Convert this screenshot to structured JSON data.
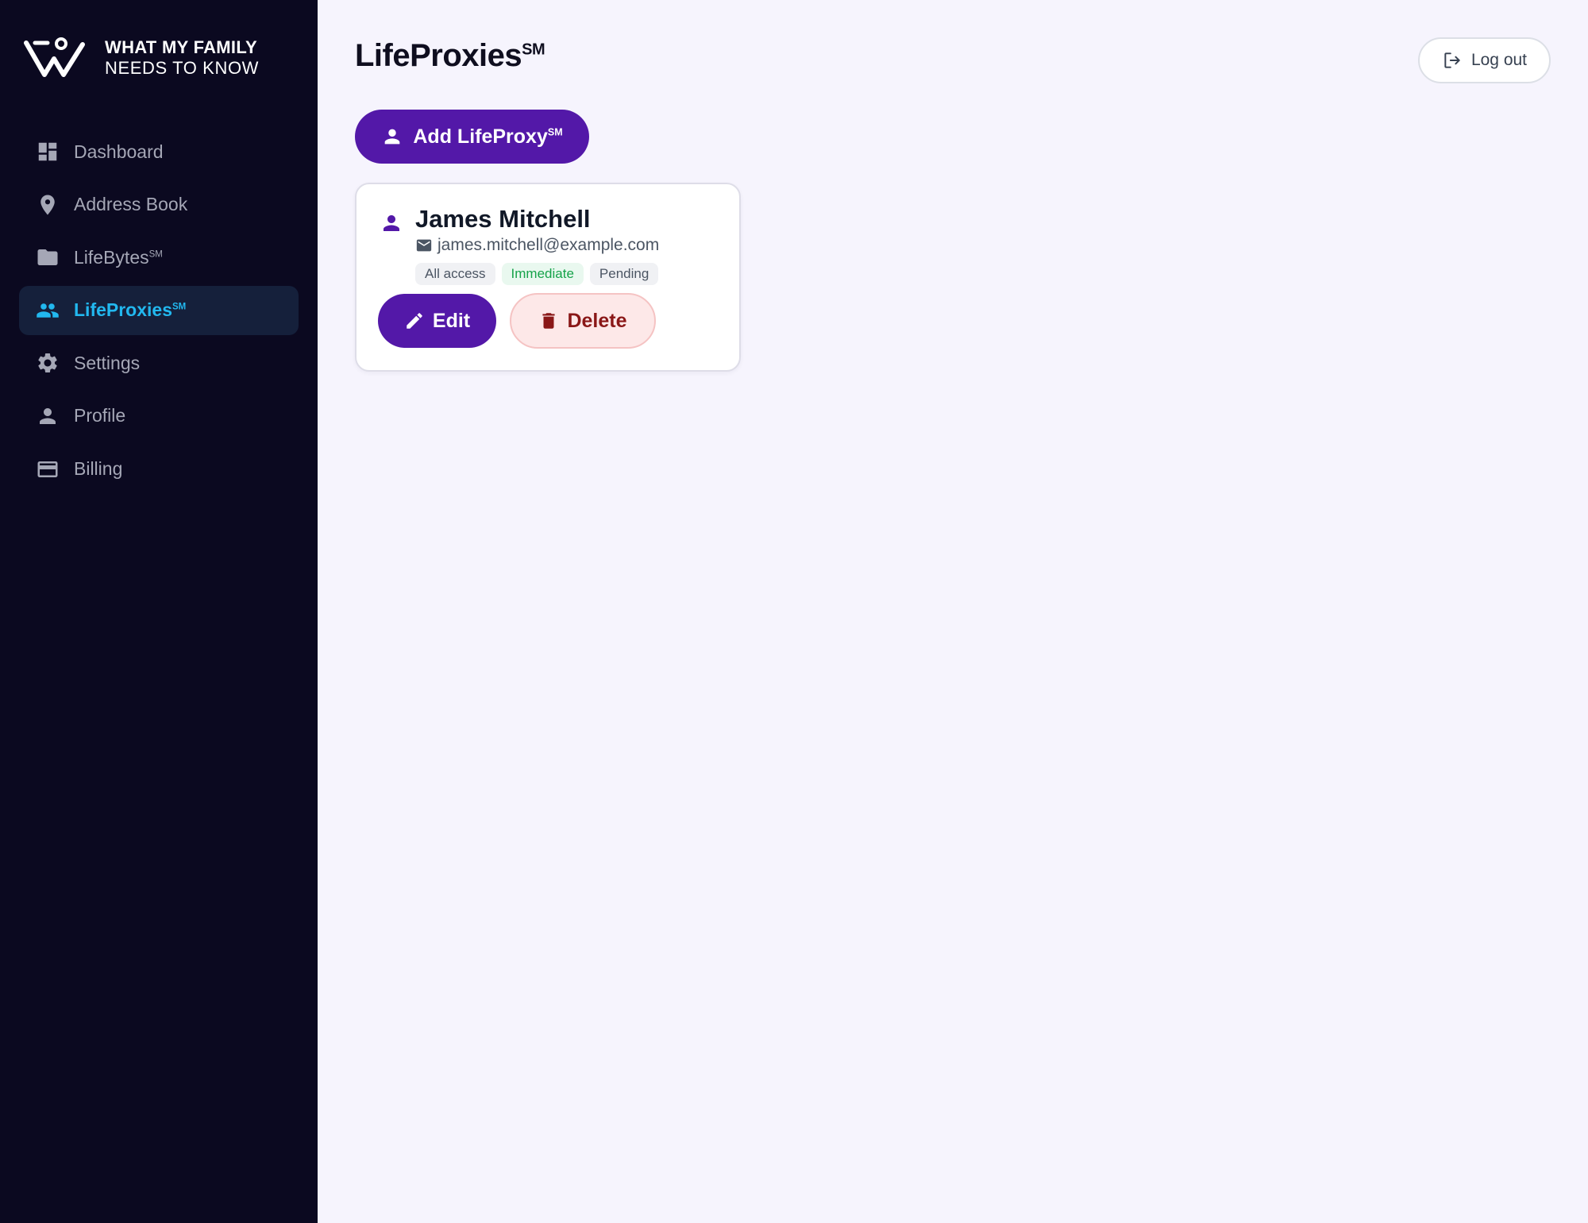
{
  "brand": {
    "line1": "WHAT MY FAMILY",
    "line2": "NEEDS TO KNOW"
  },
  "sidebar": {
    "items": [
      {
        "label": "Dashboard",
        "sup": "",
        "icon": "dashboard-icon",
        "active": false
      },
      {
        "label": "Address Book",
        "sup": "",
        "icon": "location-pin-icon",
        "active": false
      },
      {
        "label": "LifeBytes",
        "sup": "SM",
        "icon": "folder-icon",
        "active": false
      },
      {
        "label": "LifeProxies",
        "sup": "SM",
        "icon": "people-icon",
        "active": true
      },
      {
        "label": "Settings",
        "sup": "",
        "icon": "gear-icon",
        "active": false
      },
      {
        "label": "Profile",
        "sup": "",
        "icon": "person-icon",
        "active": false
      },
      {
        "label": "Billing",
        "sup": "",
        "icon": "credit-card-icon",
        "active": false
      }
    ]
  },
  "page": {
    "title": "LifeProxies",
    "title_sup": "SM"
  },
  "header": {
    "logout_label": "Log out"
  },
  "actions": {
    "add_label": "Add LifeProxy",
    "add_sup": "SM"
  },
  "proxies": [
    {
      "name": "James Mitchell",
      "email": "james.mitchell@example.com",
      "badges": [
        "All access",
        "Immediate",
        "Pending"
      ],
      "edit_label": "Edit",
      "delete_label": "Delete"
    }
  ],
  "colors": {
    "sidebar_bg": "#0b0920",
    "active_accent": "#22b8ef",
    "primary": "#5318a8",
    "danger_text": "#8a1717",
    "danger_bg": "#fde8e8",
    "success_text": "#16a34a",
    "page_bg": "#f6f4fd"
  }
}
